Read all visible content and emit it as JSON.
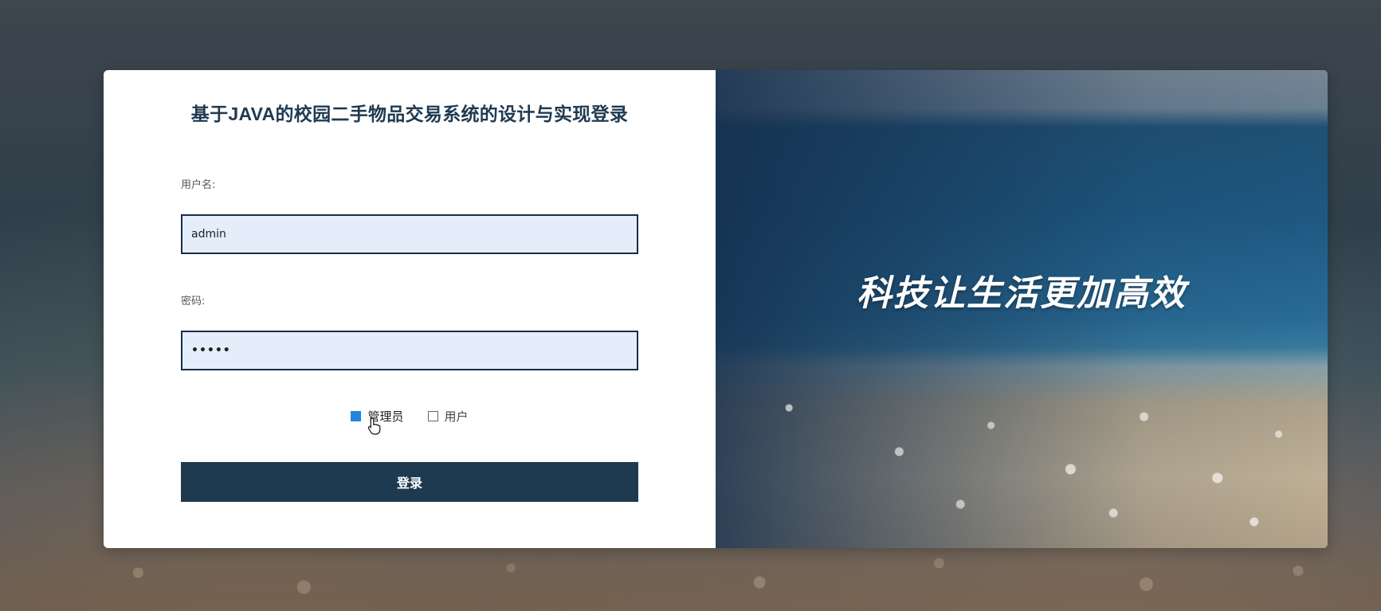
{
  "login": {
    "title": "基于JAVA的校园二手物品交易系统的设计与实现登录",
    "username_label": "用户名:",
    "username_value": "admin",
    "password_label": "密码:",
    "password_value": "•••••",
    "roles": [
      {
        "label": "管理员",
        "selected": true
      },
      {
        "label": "用户",
        "selected": false
      }
    ],
    "login_button": "登录"
  },
  "banner": {
    "slogan": "科技让生活更加高效"
  },
  "colors": {
    "primary": "#1e3a50",
    "input_border": "#1a2a48",
    "input_bg": "#e4eefa",
    "radio_checked": "#1f86e0"
  },
  "icons": {
    "cursor": "hand-pointer-icon"
  }
}
